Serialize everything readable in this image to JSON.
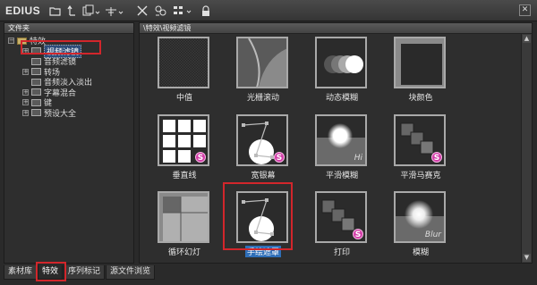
{
  "app": {
    "title": "EDIUS"
  },
  "toolbar": {
    "icons": [
      "open-folder-icon",
      "up-folder-icon",
      "copy-icon",
      "sort-icon",
      "delete-icon",
      "properties-icon",
      "view-icon",
      "lock-icon"
    ]
  },
  "window": {
    "close": "✕"
  },
  "left_pane": {
    "header": "文件夹",
    "tree": [
      {
        "label": "特效",
        "expander": "−",
        "level": 0
      },
      {
        "label": "视频滤镜",
        "expander": "+",
        "level": 1
      },
      {
        "label": "音频滤镜",
        "expander": "",
        "level": 1
      },
      {
        "label": "转场",
        "expander": "+",
        "level": 1
      },
      {
        "label": "音频淡入淡出",
        "expander": "",
        "level": 1
      },
      {
        "label": "字幕混合",
        "expander": "+",
        "level": 1
      },
      {
        "label": "键",
        "expander": "+",
        "level": 1
      },
      {
        "label": "预设大全",
        "expander": "+",
        "level": 1
      }
    ]
  },
  "bottom_tabs": [
    "素材库",
    "特效",
    "序列标记",
    "源文件浏览"
  ],
  "right_pane": {
    "path": "\\特效\\视频滤镜",
    "effects": [
      {
        "label": "中值",
        "thumb": "noise"
      },
      {
        "label": "光栅滚动",
        "thumb": "raster"
      },
      {
        "label": "动态模糊",
        "thumb": "motion-blur"
      },
      {
        "label": "块颜色",
        "thumb": "block-color"
      },
      {
        "label": "垂直线",
        "thumb": "grid"
      },
      {
        "label": "宽银幕",
        "thumb": "curve",
        "badge": "S"
      },
      {
        "label": "平滑模糊",
        "thumb": "sun",
        "tag": "Hi"
      },
      {
        "label": "平滑马赛克",
        "thumb": "squares",
        "badge": "S"
      },
      {
        "label": "循环幻灯",
        "thumb": "loop"
      },
      {
        "label": "手绘遮罩",
        "thumb": "curve2"
      },
      {
        "label": "打印",
        "thumb": "squares2",
        "badge": "S"
      },
      {
        "label": "模糊",
        "thumb": "sun2",
        "tag": "Blur"
      }
    ]
  },
  "colors": {
    "highlight": "#d2262b",
    "selection": "#2f6fb8",
    "badge": "#d23ca8"
  }
}
